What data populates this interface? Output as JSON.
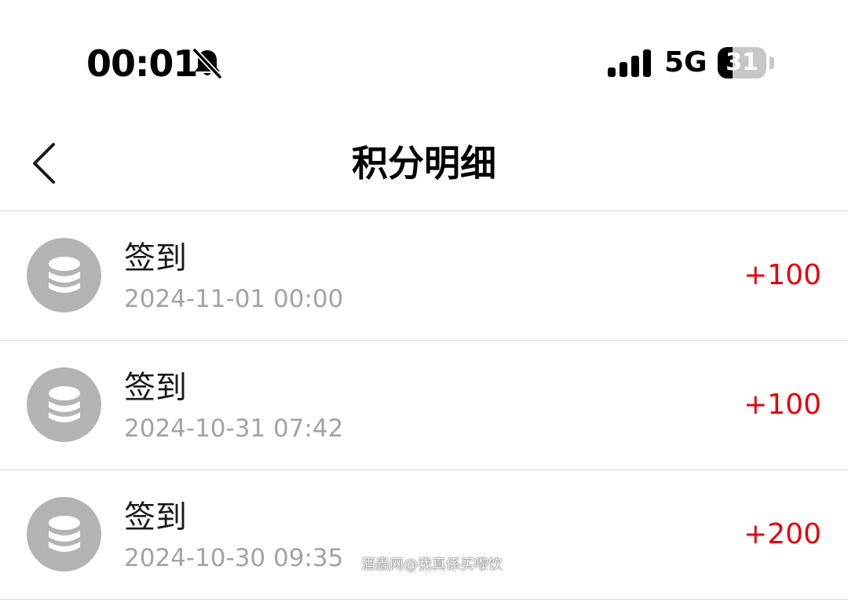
{
  "status_bar": {
    "time": "00:01",
    "network": "5G",
    "battery_level": "31",
    "battery_fraction": 0.31
  },
  "nav": {
    "title": "积分明细"
  },
  "records": [
    {
      "title": "签到",
      "time": "2024-11-01 00:00",
      "points": "+100"
    },
    {
      "title": "签到",
      "time": "2024-10-31 07:42",
      "points": "+100"
    },
    {
      "title": "签到",
      "time": "2024-10-30 09:35",
      "points": "+200"
    }
  ],
  "watermark": "酒蟲网@我真係买嚟饮",
  "colors": {
    "points": "#e8000b",
    "avatar_bg": "#b3b3b3",
    "secondary_text": "#a3a3a3"
  },
  "icons": {
    "back": "chevron-left-icon",
    "record": "coin-stack-icon",
    "silent": "bell-slash-icon"
  }
}
